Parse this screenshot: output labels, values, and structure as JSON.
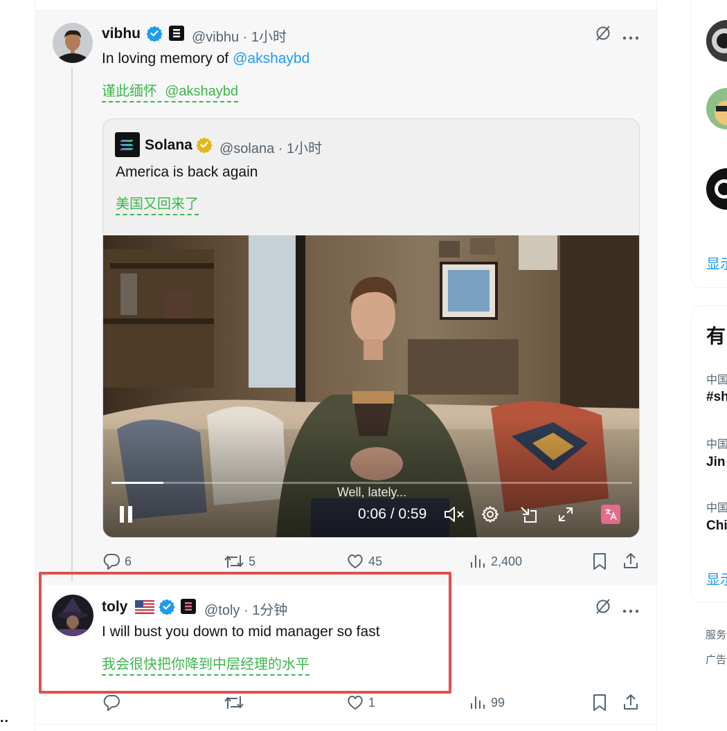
{
  "post1": {
    "name": "vibhu",
    "handle": "@vibhu",
    "time": "1小时",
    "text_prefix": "In loving memory of ",
    "text_mention": "@akshaybd",
    "translation_text": "谨此缅怀",
    "translation_mention": "@akshaybd",
    "metrics": {
      "replies": "6",
      "reposts": "5",
      "likes": "45",
      "views": "2,400"
    }
  },
  "quote": {
    "name": "Solana",
    "handle": "@solana",
    "time": "1小时",
    "text": "America is back again",
    "translation": "美国又回来了",
    "video": {
      "caption": "Well, lately...",
      "time_display": "0:06 / 0:59",
      "progress": 0.1
    }
  },
  "post2": {
    "name": "toly",
    "handle": "@toly",
    "time": "1分钟",
    "text": "I will bust you down to mid manager so fast",
    "translation": "我会很快把你降到中层经理的水平",
    "metrics": {
      "replies": "",
      "reposts": "",
      "likes": "1",
      "views": "99"
    }
  },
  "left_edge": {
    "more": ".."
  },
  "sidebar": {
    "show_more_1": "显示",
    "trends_heading": "有",
    "trends": [
      {
        "category": "中国",
        "title": "#sh"
      },
      {
        "category": "中国",
        "title": "Jin"
      },
      {
        "category": "中国",
        "title": "Chi"
      }
    ],
    "show_more_2": "显示",
    "footer_1": "服务",
    "footer_2": "广告"
  },
  "colors": {
    "accent": "#1d9bf0",
    "translation": "#3bb64a",
    "highlight": "#e0504d",
    "verified": "#1d9bf0",
    "gold": "#e2b719"
  }
}
